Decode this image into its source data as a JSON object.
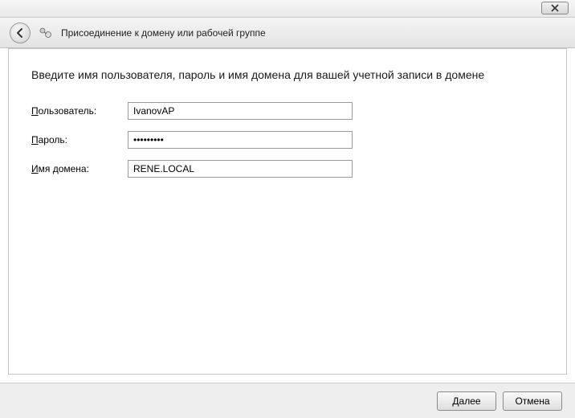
{
  "window": {
    "wizard_title": "Присоединение к домену или рабочей группе"
  },
  "heading": "Введите имя пользователя, пароль и имя домена для вашей учетной записи в домене",
  "form": {
    "username": {
      "label_pre": "П",
      "label_rest": "ользователь:",
      "value": "IvanovAP"
    },
    "password": {
      "label_pre": "П",
      "label_rest": "ароль:",
      "value": "•••••••••"
    },
    "domain": {
      "label_pre": "И",
      "label_rest": "мя домена:",
      "value": "RENE.LOCAL"
    }
  },
  "footer": {
    "next": "Далее",
    "cancel": "Отмена"
  }
}
